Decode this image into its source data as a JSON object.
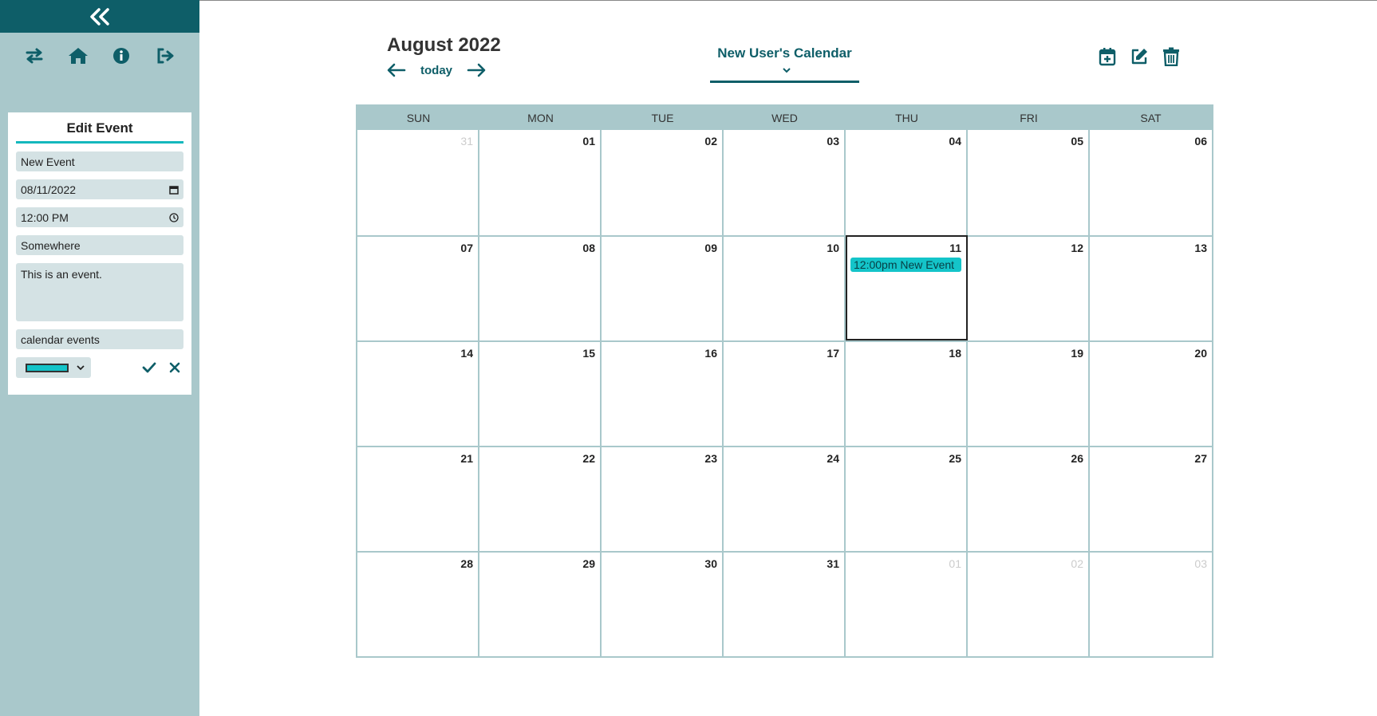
{
  "sidebar": {
    "collapse_icon": "double-chevron-left-icon",
    "nav_icons": [
      "swap-icon",
      "home-icon",
      "info-icon",
      "logout-icon"
    ]
  },
  "edit_event": {
    "title": "Edit Event",
    "name": "New Event",
    "date": "08/11/2022",
    "time": "12:00 PM",
    "location": "Somewhere",
    "description": "This is an event.",
    "calendar": "calendar events",
    "color": "#14c4c9"
  },
  "header": {
    "month_title": "August 2022",
    "today_label": "today",
    "calendar_name": "New User's Calendar"
  },
  "toolbar": [
    "calendar-plus-icon",
    "edit-icon",
    "trash-icon"
  ],
  "weekdays": [
    "SUN",
    "MON",
    "TUE",
    "WED",
    "THU",
    "FRI",
    "SAT"
  ],
  "days": [
    {
      "n": "31",
      "muted": true
    },
    {
      "n": "01"
    },
    {
      "n": "02"
    },
    {
      "n": "03"
    },
    {
      "n": "04"
    },
    {
      "n": "05"
    },
    {
      "n": "06"
    },
    {
      "n": "07"
    },
    {
      "n": "08"
    },
    {
      "n": "09"
    },
    {
      "n": "10"
    },
    {
      "n": "11",
      "today": true,
      "events": [
        "12:00pm New Event"
      ]
    },
    {
      "n": "12"
    },
    {
      "n": "13"
    },
    {
      "n": "14"
    },
    {
      "n": "15"
    },
    {
      "n": "16"
    },
    {
      "n": "17"
    },
    {
      "n": "18"
    },
    {
      "n": "19"
    },
    {
      "n": "20"
    },
    {
      "n": "21"
    },
    {
      "n": "22"
    },
    {
      "n": "23"
    },
    {
      "n": "24"
    },
    {
      "n": "25"
    },
    {
      "n": "26"
    },
    {
      "n": "27"
    },
    {
      "n": "28"
    },
    {
      "n": "29"
    },
    {
      "n": "30"
    },
    {
      "n": "31"
    },
    {
      "n": "01",
      "muted": true
    },
    {
      "n": "02",
      "muted": true
    },
    {
      "n": "03",
      "muted": true
    }
  ],
  "colors": {
    "accent": "#0e5e68",
    "sidebar": "#a9c8cb",
    "event": "#14c4c9"
  }
}
